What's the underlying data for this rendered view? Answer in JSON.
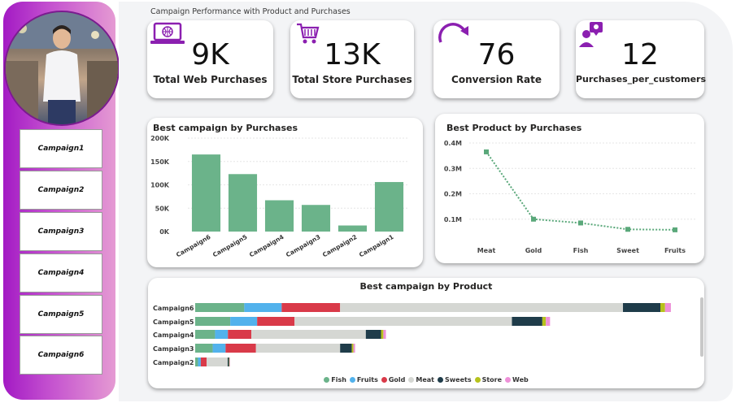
{
  "page_title": "Campaign Performance with Product and Purchases",
  "sidebar": {
    "buttons": [
      "Campaign1",
      "Campaign2",
      "Campaign3",
      "Campaign4",
      "Campaign5",
      "Campaign6"
    ]
  },
  "kpis": [
    {
      "value": "9K",
      "label": "Total Web Purchases",
      "icon": "laptop-icon"
    },
    {
      "value": "13K",
      "label": "Total Store Purchases",
      "icon": "shopping-cart-icon"
    },
    {
      "value": "76",
      "label": "Conversion Rate",
      "icon": "refresh-arrow-icon"
    },
    {
      "value": "12",
      "label": "Purchases_per_customers",
      "icon": "person-location-icon"
    }
  ],
  "colors": {
    "accent": "#a31ac4",
    "bar_green": "#6bb38a",
    "line_green": "#5aa87a"
  },
  "chart_data": [
    {
      "type": "bar",
      "title": "Best campaign by Purchases",
      "categories": [
        "Campaign6",
        "Campaign5",
        "Campaign4",
        "Campaign3",
        "Campaign2",
        "Campaign1"
      ],
      "values": [
        165000,
        123000,
        67000,
        57000,
        13000,
        106000
      ],
      "ylim": [
        0,
        200000
      ],
      "yticks": [
        "0K",
        "50K",
        "100K",
        "150K",
        "200K"
      ],
      "xlabel": "",
      "ylabel": "",
      "grid": true
    },
    {
      "type": "line",
      "title": "Best Product by Purchases",
      "categories": [
        "Meat",
        "Gold",
        "Fish",
        "Sweet",
        "Fruits"
      ],
      "values": [
        365000,
        100000,
        85000,
        60000,
        58000
      ],
      "ylim": [
        0,
        400000
      ],
      "yticks": [
        "0.1M",
        "0.2M",
        "0.3M",
        "0.4M"
      ],
      "grid": true
    },
    {
      "type": "bar",
      "orientation": "horizontal-stacked",
      "title": "Best campaign by Product",
      "categories": [
        "Campaign6",
        "Campaign5",
        "Campaign4",
        "Campaign3",
        "Campaign2"
      ],
      "series": [
        {
          "name": "Fish",
          "color": "#6bb38a",
          "values": [
            21000,
            15000,
            8500,
            7500,
            1200
          ]
        },
        {
          "name": "Fruits",
          "color": "#52b2ec",
          "values": [
            16000,
            11500,
            5500,
            5500,
            1200
          ]
        },
        {
          "name": "Gold",
          "color": "#d93a49",
          "values": [
            25000,
            16000,
            10000,
            13000,
            2500
          ]
        },
        {
          "name": "Meat",
          "color": "#d5d7d3",
          "values": [
            121000,
            93000,
            49000,
            36000,
            9000
          ]
        },
        {
          "name": "Sweets",
          "color": "#1f3c4a",
          "values": [
            16000,
            13000,
            6500,
            5000,
            600
          ]
        },
        {
          "name": "Store",
          "color": "#b6c21c",
          "values": [
            2000,
            1500,
            1000,
            700,
            200
          ]
        },
        {
          "name": "Web",
          "color": "#ee91d8",
          "values": [
            2500,
            1800,
            1100,
            700,
            200
          ]
        }
      ],
      "xlim": [
        0,
        215000
      ],
      "legend": "bottom-center"
    }
  ]
}
